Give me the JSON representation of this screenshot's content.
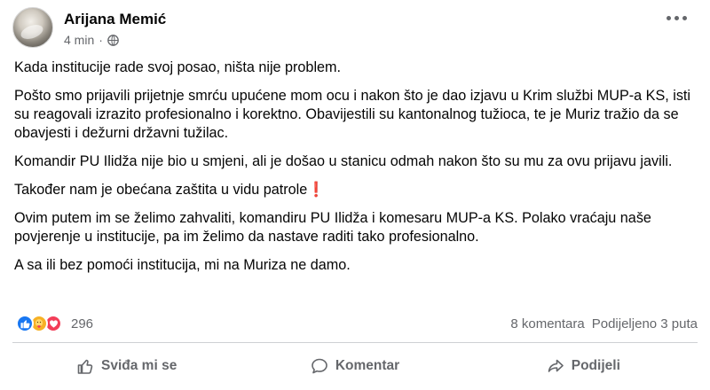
{
  "post": {
    "author": "Arijana Memić",
    "time": "4 min",
    "separator": "·",
    "paragraphs": [
      "Kada institucije rade svoj posao, ništa nije problem.",
      "Pošto smo prijavili prijetnje smrću upućene mom ocu i nakon što je dao izjavu u Krim službi MUP-a KS, isti su reagovali izrazito profesionalno i korektno. Obavijestili su kantonalnog tužioca, te je Muriz tražio da se obavjesti i dežurni državni tužilac.",
      "Komandir PU Ilidža nije bio u smjeni, ali je došao u stanicu odmah nakon što su mu za ovu prijavu javili.",
      "Također nam je obećana zaštita u vidu patrole",
      "Ovim putem im se želimo zahvaliti, komandiru PU Ilidža i komesaru MUP-a KS. Polako vraćaju naše povjerenje u institucije, pa im želimo da nastave raditi tako profesionalno.",
      "A sa ili bez pomoći institucija, mi na Muriza ne damo."
    ],
    "exclamation": "❗"
  },
  "stats": {
    "reaction_count": "296",
    "comments": "8 komentara",
    "shares": "Podijeljeno 3 puta"
  },
  "actions": {
    "like": "Sviđa mi se",
    "comment": "Komentar",
    "share": "Podijeli"
  },
  "colors": {
    "like_blue": "#1877f2",
    "care_yellow": "#f7b125",
    "love_red": "#f33e58",
    "secondary_text": "#65676b"
  }
}
